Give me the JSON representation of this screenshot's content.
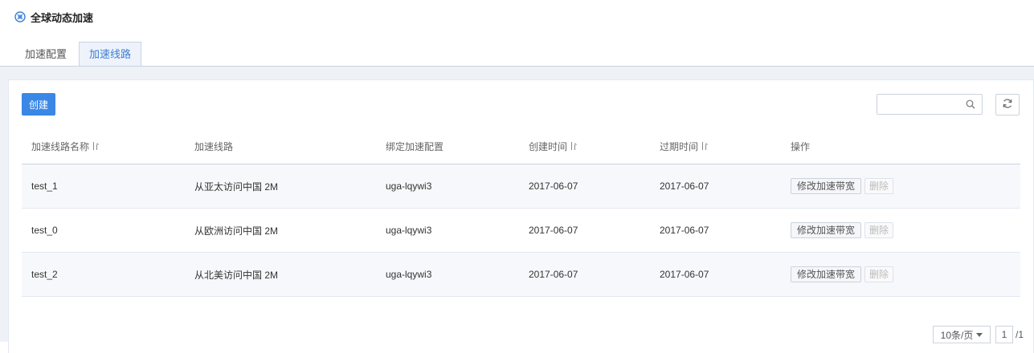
{
  "header": {
    "title": "全球动态加速",
    "icon": "global-accel-icon"
  },
  "tabs": [
    {
      "label": "加速配置",
      "active": false
    },
    {
      "label": "加速线路",
      "active": true
    }
  ],
  "toolbar": {
    "create_label": "创建",
    "search_placeholder": ""
  },
  "table": {
    "columns": [
      "加速线路名称",
      "加速线路",
      "绑定加速配置",
      "创建时间",
      "过期时间",
      "操作"
    ],
    "rows": [
      {
        "name": "test_1",
        "route": "从亚太访问中国 2M",
        "config": "uga-lqywi3",
        "created": "2017-06-07",
        "expires": "2017-06-07",
        "modify": "修改加速带宽",
        "delete": "删除"
      },
      {
        "name": "test_0",
        "route": "从欧洲访问中国 2M",
        "config": "uga-lqywi3",
        "created": "2017-06-07",
        "expires": "2017-06-07",
        "modify": "修改加速带宽",
        "delete": "删除"
      },
      {
        "name": "test_2",
        "route": "从北美访问中国 2M",
        "config": "uga-lqywi3",
        "created": "2017-06-07",
        "expires": "2017-06-07",
        "modify": "修改加速带宽",
        "delete": "删除"
      }
    ]
  },
  "pagination": {
    "page_size": "10条/页",
    "current_page": "1",
    "total": "/1"
  },
  "colors": {
    "accent": "#3a87e6",
    "tab_active_text": "#3a7fd5",
    "content_bg": "#eef1f6"
  }
}
